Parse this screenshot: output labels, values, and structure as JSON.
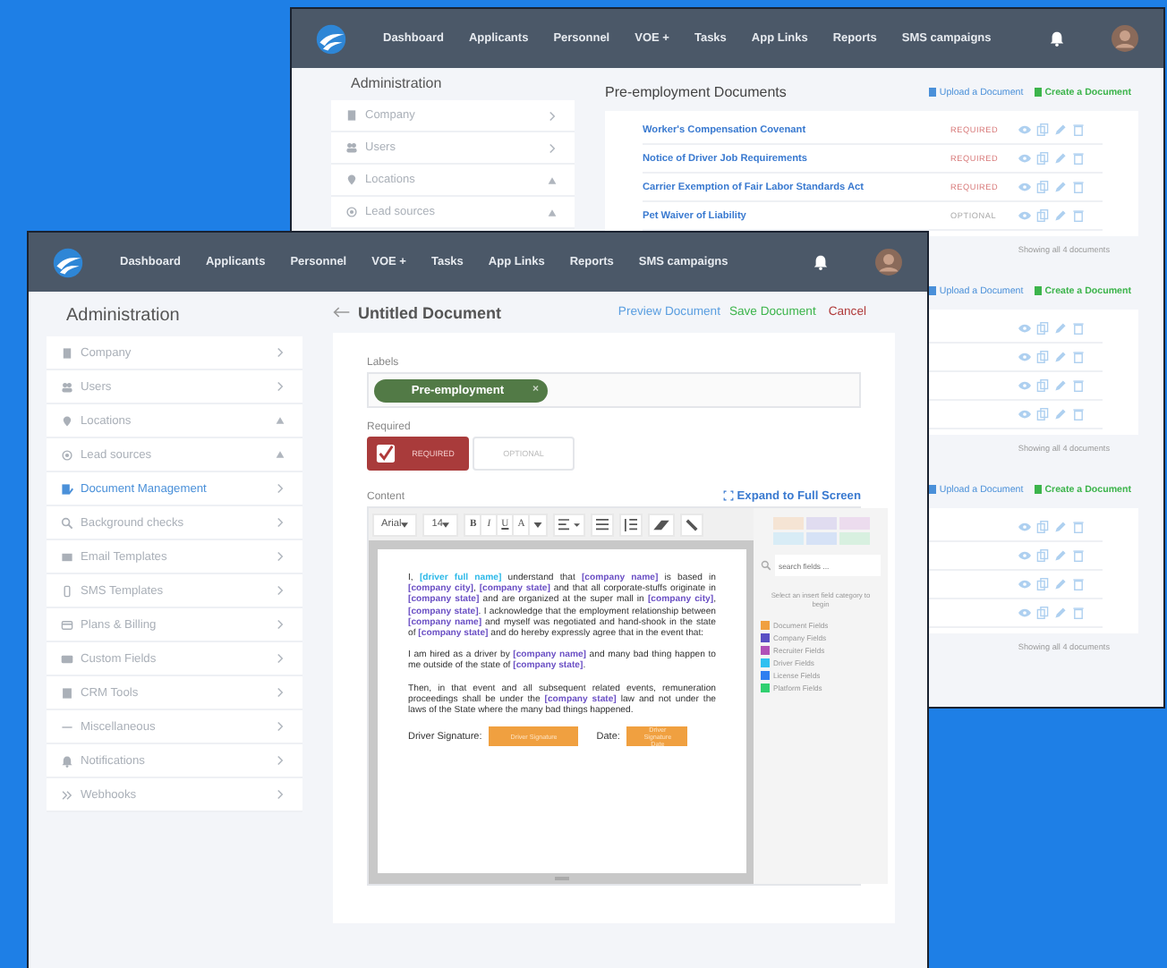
{
  "back_window": {
    "nav": {
      "items": [
        "Dashboard",
        "Applicants",
        "Personnel",
        "VOE +",
        "Tasks",
        "App Links",
        "Reports",
        "SMS campaigns"
      ]
    },
    "sidebar": {
      "title": "Administration",
      "items": [
        {
          "label": "Company",
          "kind": "chevron"
        },
        {
          "label": "Users",
          "kind": "chevron"
        },
        {
          "label": "Locations",
          "kind": "warning"
        },
        {
          "label": "Lead sources",
          "kind": "warning"
        }
      ]
    },
    "sections": [
      {
        "title": "Pre-employment Documents",
        "upload": "Upload a Document",
        "create": "Create a Document",
        "rows": [
          {
            "title": "Worker's Compensation Covenant",
            "status": "REQUIRED",
            "required": true
          },
          {
            "title": "Notice of Driver Job Requirements",
            "status": "REQUIRED",
            "required": true
          },
          {
            "title": "Carrier Exemption of Fair Labor Standards Act",
            "status": "REQUIRED",
            "required": true
          },
          {
            "title": "Pet Waiver of Liability",
            "status": "OPTIONAL",
            "required": false
          }
        ],
        "footer": "Showing all 4 documents"
      },
      {
        "upload": "Upload a Document",
        "create": "Create a Document",
        "rows": [
          {
            "kind": "document"
          },
          {
            "kind": "document"
          },
          {
            "kind": "document"
          },
          {
            "kind": "document"
          }
        ],
        "footer": "Showing all 4 documents"
      },
      {
        "upload": "Upload a Document",
        "create": "Create a Document",
        "rows": [
          {
            "kind": "document"
          },
          {
            "kind": "document"
          },
          {
            "kind": "document"
          },
          {
            "kind": "document"
          }
        ],
        "footer": "Showing all 4 documents"
      }
    ]
  },
  "front_window": {
    "nav": {
      "items": [
        "Dashboard",
        "Applicants",
        "Personnel",
        "VOE +",
        "Tasks",
        "App Links",
        "Reports",
        "SMS campaigns"
      ]
    },
    "sidebar": {
      "title": "Administration",
      "items": [
        {
          "label": "Company",
          "kind": "chevron",
          "selected": false
        },
        {
          "label": "Users",
          "kind": "chevron",
          "selected": false
        },
        {
          "label": "Locations",
          "kind": "warning",
          "selected": false
        },
        {
          "label": "Lead sources",
          "kind": "warning",
          "selected": false
        },
        {
          "label": "Document Management",
          "kind": "chevron",
          "selected": true
        },
        {
          "label": "Background checks",
          "kind": "chevron",
          "selected": false
        },
        {
          "label": "Email Templates",
          "kind": "chevron",
          "selected": false
        },
        {
          "label": "SMS Templates",
          "kind": "chevron",
          "selected": false
        },
        {
          "label": "Plans & Billing",
          "kind": "chevron",
          "selected": false
        },
        {
          "label": "Custom Fields",
          "kind": "chevron",
          "selected": false
        },
        {
          "label": "CRM Tools",
          "kind": "chevron",
          "selected": false
        },
        {
          "label": "Miscellaneous",
          "kind": "chevron",
          "selected": false
        },
        {
          "label": "Notifications",
          "kind": "chevron",
          "selected": false
        },
        {
          "label": "Webhooks",
          "kind": "chevron",
          "selected": false
        }
      ]
    },
    "editor": {
      "title": "Untitled Document",
      "preview": "Preview Document",
      "save": "Save Document",
      "cancel": "Cancel",
      "labels_label": "Labels",
      "tags": [
        {
          "label": "Pre-employment",
          "remove": "×"
        }
      ],
      "required_label": "Required",
      "required_options": [
        {
          "label": "REQUIRED",
          "selected": true
        },
        {
          "label": "OPTIONAL",
          "selected": false
        }
      ],
      "content_label": "Content",
      "expand": "Expand to Full Screen",
      "toolbar": {
        "font": "Arial",
        "size": "14",
        "bold": "B",
        "italic": "I",
        "underline": "U",
        "text_color_label": "A"
      },
      "paragraphs": [
        [
          {
            "kind": "text",
            "text": "I, "
          },
          {
            "kind": "field",
            "text": "[driver full name]",
            "color": "#2bb8e8"
          },
          {
            "kind": "text",
            "text": " understand that "
          },
          {
            "kind": "field",
            "text": "[company name]",
            "color": "#6a4fc4"
          },
          {
            "kind": "text",
            "text": " is based in "
          },
          {
            "kind": "field",
            "text": "[company city]",
            "color": "#6a4fc4"
          },
          {
            "kind": "text",
            "text": ", "
          },
          {
            "kind": "field",
            "text": "[company state]",
            "color": "#6a4fc4"
          },
          {
            "kind": "text",
            "text": " and that all corporate-stuffs originate in "
          },
          {
            "kind": "field",
            "text": "[company state]",
            "color": "#6a4fc4"
          },
          {
            "kind": "text",
            "text": " and are organized at the super mall in "
          },
          {
            "kind": "field",
            "text": "[company city]",
            "color": "#6a4fc4"
          },
          {
            "kind": "text",
            "text": ", "
          },
          {
            "kind": "field",
            "text": "[company state]",
            "color": "#6a4fc4"
          },
          {
            "kind": "text",
            "text": ". I acknowledge that the employment relationship between "
          },
          {
            "kind": "field",
            "text": "[company name]",
            "color": "#6a4fc4"
          },
          {
            "kind": "text",
            "text": " and myself was negotiated and hand-shook in the state of "
          },
          {
            "kind": "field",
            "text": "[company state]",
            "color": "#6a4fc4"
          },
          {
            "kind": "text",
            "text": " and do hereby expressly agree that in the event that:"
          }
        ],
        [
          {
            "kind": "text",
            "text": "I am hired as a driver by "
          },
          {
            "kind": "field",
            "text": "[company name]",
            "color": "#6a4fc4"
          },
          {
            "kind": "text",
            "text": " and many bad thing happen to me outside of the state of "
          },
          {
            "kind": "field",
            "text": "[company state]",
            "color": "#6a4fc4"
          },
          {
            "kind": "text",
            "text": "."
          }
        ],
        [
          {
            "kind": "text",
            "text": "Then, in that event and all subsequent related events, remuneration proceedings shall be under the "
          },
          {
            "kind": "field",
            "text": "[company state]",
            "color": "#6a4fc4"
          },
          {
            "kind": "text",
            "text": " law and not under the laws of the State where the many bad things happened."
          }
        ]
      ],
      "signatures": [
        {
          "label": "Driver Signature:",
          "field": "Driver Signature"
        },
        {
          "label": "Date:",
          "field": "Driver Signature Date"
        }
      ],
      "field_panel": {
        "search_placeholder": "search fields ...",
        "hint": "Select an insert field category to begin",
        "categories": [
          {
            "name": "Document Fields",
            "color": "#f0a040"
          },
          {
            "name": "Company Fields",
            "color": "#5a4fc4"
          },
          {
            "name": "Recruiter Fields",
            "color": "#b050b8"
          },
          {
            "name": "Driver Fields",
            "color": "#30c0f0"
          },
          {
            "name": "License Fields",
            "color": "#2f7ff0"
          },
          {
            "name": "Platform Fields",
            "color": "#30d070"
          }
        ]
      }
    }
  }
}
